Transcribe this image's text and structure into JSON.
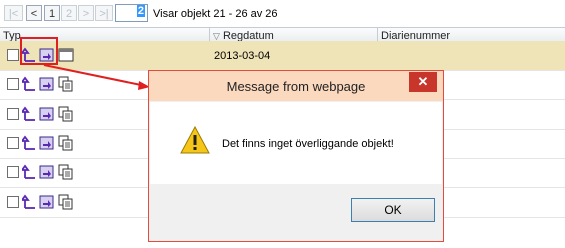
{
  "pager": {
    "first": "|<",
    "prev": "<",
    "page1": "1",
    "page2": "2",
    "next": ">",
    "last": ">|",
    "input_value": "2",
    "info": "Visar objekt 21 - 26 av 26"
  },
  "grid": {
    "columns": {
      "typ": "Typ",
      "regdatum": "Regdatum",
      "diarienummer": "Diarienummer"
    },
    "sort_indicator": "▽",
    "rows": [
      {
        "regdatum": "2013-03-04",
        "selected": true
      },
      {
        "regdatum": "",
        "selected": false
      },
      {
        "regdatum": "",
        "selected": false
      },
      {
        "regdatum": "",
        "selected": false
      },
      {
        "regdatum": "",
        "selected": false
      },
      {
        "regdatum": "",
        "selected": false
      }
    ]
  },
  "dialog": {
    "title": "Message from webpage",
    "close": "✕",
    "message": "Det finns inget överliggande objekt!",
    "ok_label": "OK"
  },
  "colors": {
    "selected_row": "#efe3b8",
    "annotation_red": "#e02020",
    "dialog_title_bg": "#fbd9bf",
    "close_button": "#c7352b",
    "icon_purple": "#5a28b4"
  }
}
